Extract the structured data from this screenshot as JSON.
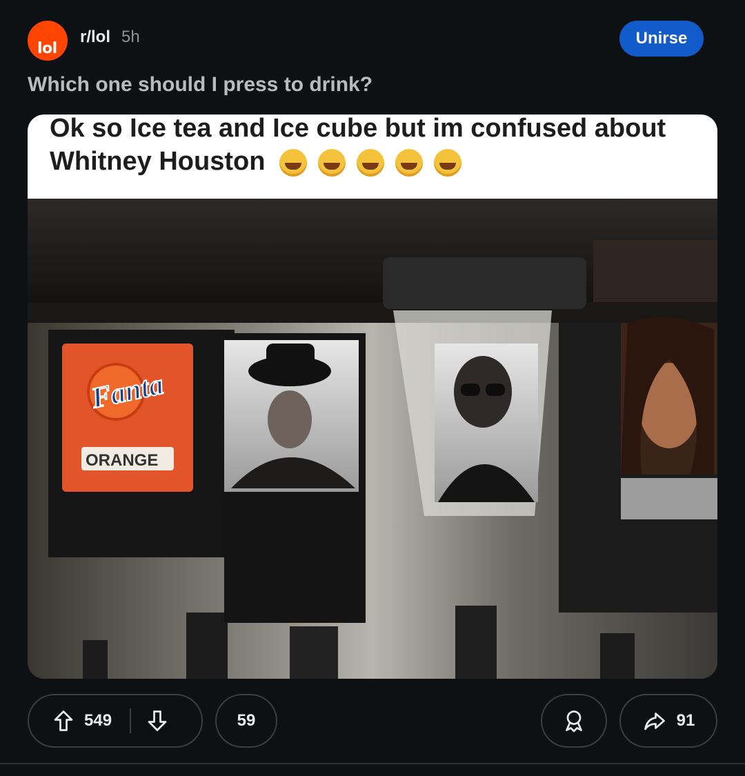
{
  "post": {
    "avatar_text": "lol",
    "subreddit": "r/lol",
    "time": "5h",
    "join_label": "Unirse",
    "title": "Which one should I press to drink?",
    "caption": "Ok so Ice tea and Ice cube but im confused about Whitney Houston"
  },
  "image_labels": {
    "fanta_logo": "Fanta",
    "fanta_flavor": "ORANGE"
  },
  "actions": {
    "upvotes": "549",
    "comments": "59",
    "shares": "91"
  },
  "colors": {
    "background": "#0e1113",
    "accent": "#115bca",
    "avatar": "#ff4500"
  }
}
